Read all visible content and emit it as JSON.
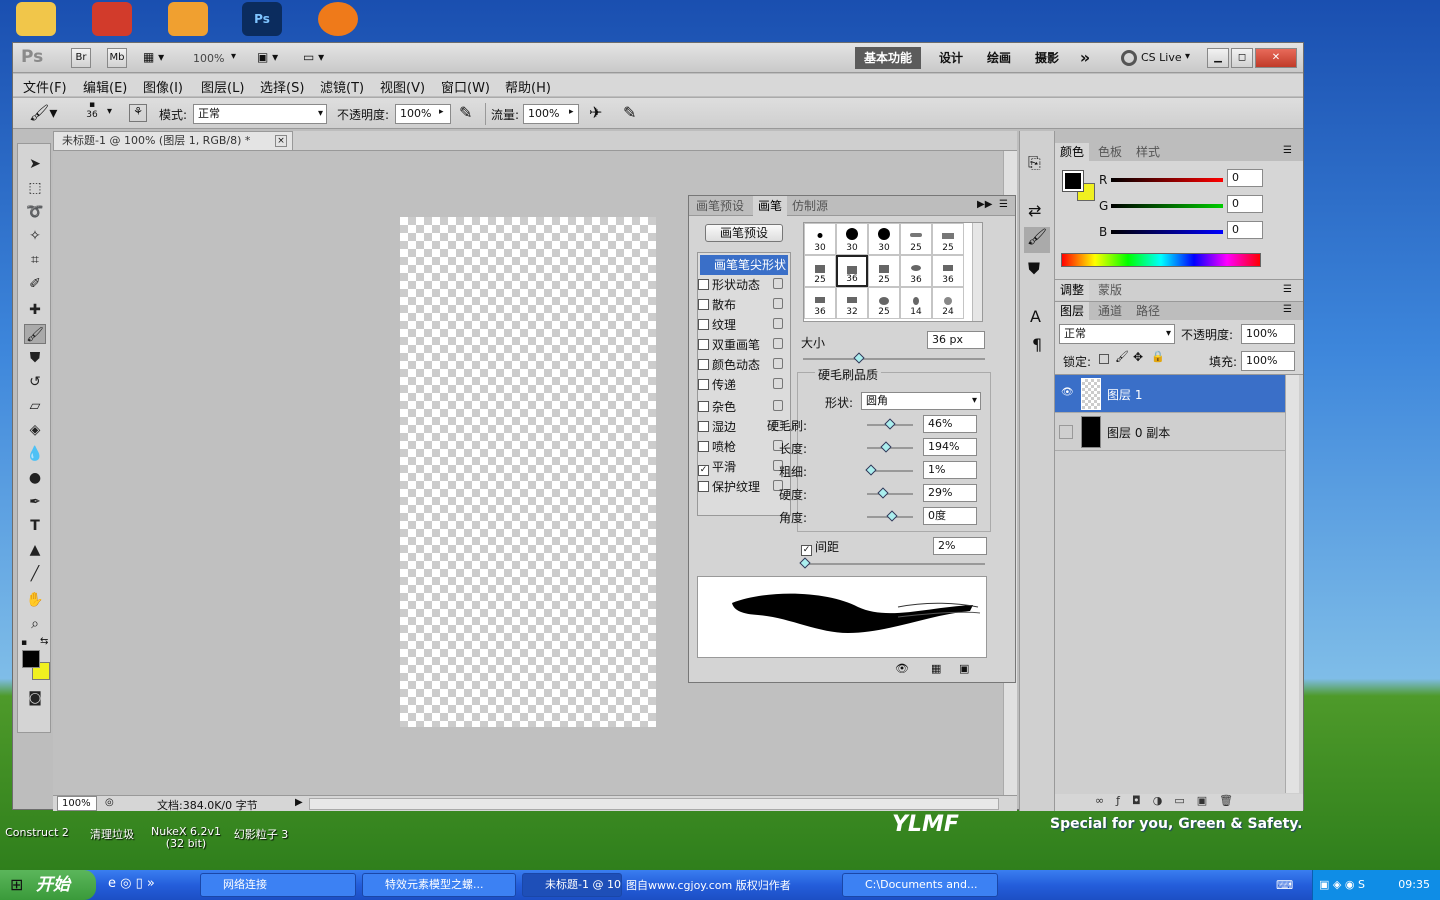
{
  "desktop": {
    "icons_top": [
      {
        "name": "folder-icon"
      },
      {
        "name": "antenna-icon"
      },
      {
        "name": "photo-viewer-icon"
      },
      {
        "name": "photoshop-icon"
      },
      {
        "name": "swirl-icon"
      }
    ],
    "icons_bottom": [
      {
        "label": "Construct 2"
      },
      {
        "label": "清理垃圾"
      },
      {
        "label": "NukeX 6.2v1 (32 bit)"
      },
      {
        "label": "幻影粒子 3"
      }
    ],
    "wallpaper_text": "Special for you, Green & Safety.",
    "wallpaper_logo": "YLMF"
  },
  "titlebar": {
    "ps": "Ps",
    "br": "Br",
    "mb": "Mb",
    "zoom": "100%",
    "workspaces": [
      "基本功能",
      "设计",
      "绘画",
      "摄影"
    ],
    "more": "»",
    "cslive": "CS Live"
  },
  "menubar": {
    "items": [
      "文件(F)",
      "编辑(E)",
      "图像(I)",
      "图层(L)",
      "选择(S)",
      "滤镜(T)",
      "视图(V)",
      "窗口(W)",
      "帮助(H)"
    ]
  },
  "options": {
    "brush_size": "36",
    "mode_label": "模式:",
    "mode_value": "正常",
    "opacity_label": "不透明度:",
    "opacity_value": "100%",
    "flow_label": "流量:",
    "flow_value": "100%"
  },
  "document": {
    "tab_title": "未标题-1 @ 100% (图层 1, RGB/8) *",
    "zoom": "100%",
    "doc_info": "文档:384.0K/0 字节"
  },
  "brush_panel": {
    "tabs": [
      "画笔预设",
      "画笔",
      "仿制源"
    ],
    "preset_button": "画笔预设",
    "options": [
      {
        "label": "画笔笔尖形状",
        "checked": null,
        "selected": true
      },
      {
        "label": "形状动态",
        "checked": false
      },
      {
        "label": "散布",
        "checked": false
      },
      {
        "label": "纹理",
        "checked": false
      },
      {
        "label": "双重画笔",
        "checked": false
      },
      {
        "label": "颜色动态",
        "checked": false
      },
      {
        "label": "传递",
        "checked": false
      },
      {
        "label": "杂色",
        "checked": false
      },
      {
        "label": "湿边",
        "checked": false
      },
      {
        "label": "喷枪",
        "checked": false
      },
      {
        "label": "平滑",
        "checked": true
      },
      {
        "label": "保护纹理",
        "checked": false
      }
    ],
    "tips": [
      "30",
      "30",
      "30",
      "25",
      "25",
      "25",
      "36",
      "25",
      "36",
      "36",
      "36",
      "32",
      "25",
      "14",
      "24"
    ],
    "size_label": "大小",
    "size_value": "36 px",
    "bristle_title": "硬毛刷品质",
    "shape_label": "形状:",
    "shape_value": "圆角",
    "params": [
      {
        "label": "硬毛刷:",
        "value": "46%",
        "pos": 0.46
      },
      {
        "label": "长度:",
        "value": "194%",
        "pos": 0.35
      },
      {
        "label": "粗细:",
        "value": "1%",
        "pos": 0.01
      },
      {
        "label": "硬度:",
        "value": "29%",
        "pos": 0.29
      },
      {
        "label": "角度:",
        "value": "0度",
        "pos": 0.5
      }
    ],
    "spacing_label": "间距",
    "spacing_value": "2%"
  },
  "color_panel": {
    "tabs": [
      "颜色",
      "色板",
      "样式"
    ],
    "channels": [
      {
        "label": "R",
        "value": "0",
        "color": "#c00000"
      },
      {
        "label": "G",
        "value": "0",
        "color": "#00a000"
      },
      {
        "label": "B",
        "value": "0",
        "color": "#0000c0"
      }
    ]
  },
  "adjust_panel": {
    "tabs": [
      "调整",
      "蒙版"
    ]
  },
  "layers_panel": {
    "tabs": [
      "图层",
      "通道",
      "路径"
    ],
    "blend": "正常",
    "opacity_label": "不透明度:",
    "opacity_value": "100%",
    "lock_label": "锁定:",
    "fill_label": "填充:",
    "fill_value": "100%",
    "layers": [
      {
        "name": "图层 1",
        "selected": true
      },
      {
        "name": "图层 0 副本",
        "selected": false
      }
    ]
  },
  "taskbar": {
    "start": "开始",
    "tasks": [
      "网络连接",
      "特效元素模型之螺...",
      "未标题-1 @ 10...",
      "C:\\Documents and..."
    ],
    "clock": "09:35",
    "overlay_text": "图自www.cgjoy.com 版权归作者"
  },
  "colors": {
    "selected_blue": "#3a6fc8",
    "accent": "#1f4fd0"
  }
}
